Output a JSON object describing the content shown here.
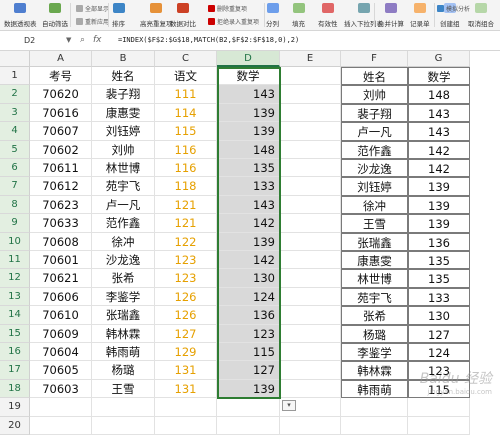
{
  "ribbon": {
    "items": [
      {
        "label": "数据透视表",
        "icon": "pivot-table-icon",
        "color": "#4f7ecf"
      },
      {
        "label": "自动筛选",
        "icon": "filter-icon",
        "color": "#6aa84f"
      },
      {
        "label": "排序",
        "icon": "sort-icon",
        "color": "#3d85c6"
      },
      {
        "label": "高亮重复项",
        "icon": "highlight-duplicates-icon",
        "color": "#e69138"
      },
      {
        "label": "数据对比",
        "icon": "compare-icon",
        "color": "#cc4125"
      },
      {
        "label": "分列",
        "icon": "split-column-icon",
        "color": "#6d9eeb"
      },
      {
        "label": "填充",
        "icon": "fill-icon",
        "color": "#93c47d"
      },
      {
        "label": "有效性",
        "icon": "validation-icon",
        "color": "#e06666"
      },
      {
        "label": "插入下拉列表",
        "icon": "dropdown-list-icon",
        "color": "#76a5af"
      },
      {
        "label": "合并计算",
        "icon": "consolidate-icon",
        "color": "#8e7cc3"
      },
      {
        "label": "记录单",
        "icon": "record-form-icon",
        "color": "#f6b26b"
      },
      {
        "label": "创建组",
        "icon": "create-group-icon",
        "color": "#a4c2f4"
      },
      {
        "label": "取消组合",
        "icon": "ungroup-icon",
        "color": "#b6d7a8"
      }
    ],
    "small": {
      "reapply": "全部显示",
      "reapply2": "重新应用",
      "delete_dup": "删除重复项",
      "reject_dup": "拒绝录入重复项",
      "sim_analysis": "模拟分析"
    }
  },
  "formula_bar": {
    "name_box": "D2",
    "fx": "fx",
    "formula": "=INDEX($F$2:$G$18,MATCH(B2,$F$2:$F$18,0),2)"
  },
  "columns": [
    "A",
    "B",
    "C",
    "D",
    "E",
    "F",
    "G"
  ],
  "rows": [
    "1",
    "2",
    "3",
    "4",
    "5",
    "6",
    "7",
    "8",
    "9",
    "10",
    "11",
    "12",
    "13",
    "14",
    "15",
    "16",
    "17",
    "18",
    "19",
    "20"
  ],
  "table_left": {
    "headers": [
      "考号",
      "姓名",
      "语文",
      "数学"
    ],
    "rows": [
      [
        "70620",
        "裴子翔",
        "111",
        "143"
      ],
      [
        "70616",
        "康惠雯",
        "114",
        "139"
      ],
      [
        "70607",
        "刘钰婷",
        "115",
        "139"
      ],
      [
        "70602",
        "刘帅",
        "116",
        "148"
      ],
      [
        "70611",
        "林世博",
        "116",
        "135"
      ],
      [
        "70612",
        "苑宇飞",
        "118",
        "133"
      ],
      [
        "70623",
        "卢一凡",
        "121",
        "143"
      ],
      [
        "70633",
        "范作鑫",
        "121",
        "142"
      ],
      [
        "70608",
        "徐冲",
        "122",
        "139"
      ],
      [
        "70601",
        "沙龙逸",
        "123",
        "142"
      ],
      [
        "70621",
        "张希",
        "123",
        "130"
      ],
      [
        "70606",
        "李鉴学",
        "126",
        "124"
      ],
      [
        "70610",
        "张瑞鑫",
        "126",
        "136"
      ],
      [
        "70609",
        "韩林霖",
        "127",
        "123"
      ],
      [
        "70604",
        "韩雨萌",
        "129",
        "115"
      ],
      [
        "70605",
        "杨璐",
        "131",
        "127"
      ],
      [
        "70603",
        "王雪",
        "131",
        "139"
      ]
    ]
  },
  "table_right": {
    "headers": [
      "姓名",
      "数学"
    ],
    "rows": [
      [
        "刘帅",
        "148"
      ],
      [
        "裴子翔",
        "143"
      ],
      [
        "卢一凡",
        "143"
      ],
      [
        "范作鑫",
        "142"
      ],
      [
        "沙龙逸",
        "142"
      ],
      [
        "刘钰婷",
        "139"
      ],
      [
        "徐冲",
        "139"
      ],
      [
        "王雪",
        "139"
      ],
      [
        "张瑞鑫",
        "136"
      ],
      [
        "康惠雯",
        "135"
      ],
      [
        "林世博",
        "135"
      ],
      [
        "苑宇飞",
        "133"
      ],
      [
        "张希",
        "130"
      ],
      [
        "杨璐",
        "127"
      ],
      [
        "李鉴学",
        "124"
      ],
      [
        "韩林霖",
        "123"
      ],
      [
        "韩雨萌",
        "115"
      ]
    ]
  },
  "watermark": {
    "main": "Baidu 经验",
    "sub": "jingyan.baidu.com"
  },
  "colors": {
    "accent": "#2e7d32",
    "orange_text": "#e6a000",
    "selection_fill": "#d9d9d9"
  }
}
